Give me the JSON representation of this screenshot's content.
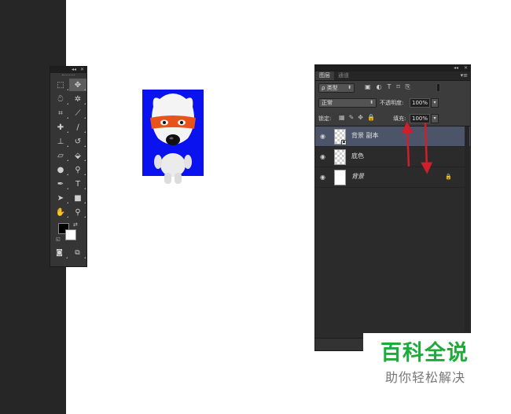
{
  "tools_panel": {
    "title_controls": {
      "collapse": "◂◂",
      "close": "✕"
    },
    "tools": [
      {
        "name": "marquee-tool-icon",
        "glyph": "⬚",
        "active": false
      },
      {
        "name": "move-tool-icon",
        "glyph": "✥",
        "active": true
      },
      {
        "name": "lasso-tool-icon",
        "glyph": "ට",
        "active": false
      },
      {
        "name": "magic-wand-tool-icon",
        "glyph": "✲",
        "active": false
      },
      {
        "name": "crop-tool-icon",
        "glyph": "⌗",
        "active": false
      },
      {
        "name": "eyedropper-tool-icon",
        "glyph": "⟋",
        "active": false
      },
      {
        "name": "healing-brush-tool-icon",
        "glyph": "✚",
        "active": false
      },
      {
        "name": "brush-tool-icon",
        "glyph": "∕",
        "active": false
      },
      {
        "name": "clone-stamp-tool-icon",
        "glyph": "⊥",
        "active": false
      },
      {
        "name": "history-brush-tool-icon",
        "glyph": "↺",
        "active": false
      },
      {
        "name": "eraser-tool-icon",
        "glyph": "▱",
        "active": false
      },
      {
        "name": "paint-bucket-tool-icon",
        "glyph": "⬙",
        "active": false
      },
      {
        "name": "blur-tool-icon",
        "glyph": "●",
        "active": false
      },
      {
        "name": "dodge-tool-icon",
        "glyph": "⚲",
        "active": false
      },
      {
        "name": "pen-tool-icon",
        "glyph": "✒",
        "active": false
      },
      {
        "name": "type-tool-icon",
        "glyph": "T",
        "active": false
      },
      {
        "name": "path-selection-tool-icon",
        "glyph": "➤",
        "active": false
      },
      {
        "name": "rectangle-tool-icon",
        "glyph": "■",
        "active": false
      },
      {
        "name": "hand-tool-icon",
        "glyph": "✋",
        "active": false
      },
      {
        "name": "zoom-tool-icon",
        "glyph": "⚲",
        "active": false
      }
    ],
    "colors": {
      "foreground": "#000000",
      "background": "#ffffff"
    }
  },
  "canvas": {
    "background_color": "#0b12f0"
  },
  "layers_panel": {
    "title_controls": {
      "collapse": "◂◂",
      "close": "✕"
    },
    "tabs": [
      {
        "label": "图层",
        "active": true
      },
      {
        "label": "通道",
        "active": false
      }
    ],
    "filter": {
      "icon": "ρ",
      "kind": "类型"
    },
    "blend_mode": "正常",
    "opacity_label": "不透明度:",
    "opacity_value": "100%",
    "lock_label": "锁定:",
    "fill_label": "填充:",
    "fill_value": "100%",
    "layers": [
      {
        "name": "背景 副本",
        "visible": true,
        "selected": true,
        "thumb": "transparent",
        "italic": false,
        "locked": false
      },
      {
        "name": "底色",
        "visible": true,
        "selected": false,
        "thumb": "transparent",
        "italic": false,
        "locked": false
      },
      {
        "name": "背景",
        "visible": true,
        "selected": false,
        "thumb": "white",
        "italic": true,
        "locked": true
      }
    ]
  },
  "watermark": {
    "logo": "百科全说",
    "tagline": "助你轻松解决"
  }
}
